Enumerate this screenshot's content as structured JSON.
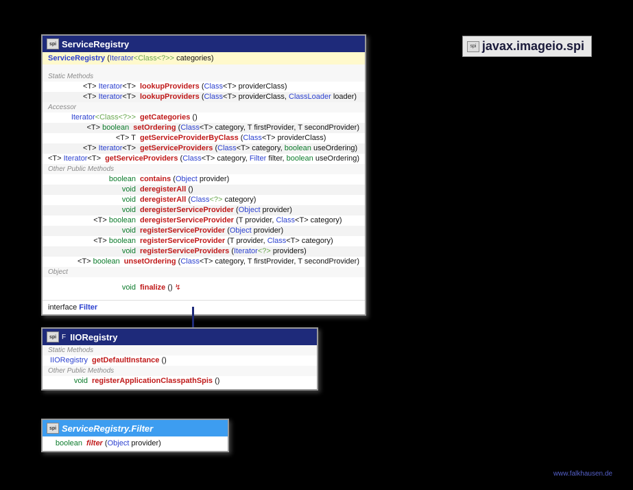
{
  "package": {
    "name": "javax.imageio.spi",
    "icon_label": "spi"
  },
  "footer": {
    "url": "www.falkhausen.de"
  },
  "service_registry": {
    "title": "ServiceRegistry",
    "constructor": {
      "name": "ServiceRegistry",
      "params": "(Iterator<Class<?>> categories)"
    },
    "sections": {
      "static": "Static Methods",
      "accessor": "Accessor",
      "other": "Other Public Methods",
      "object": "Object"
    },
    "static_methods": [
      {
        "ret_prefix": "<T> ",
        "ret": "Iterator<T>",
        "name": "lookupProviders",
        "params": "(Class<T> providerClass)"
      },
      {
        "ret_prefix": "<T> ",
        "ret": "Iterator<T>",
        "name": "lookupProviders",
        "params": "(Class<T> providerClass, ClassLoader loader)"
      }
    ],
    "accessor_methods": [
      {
        "ret_prefix": "",
        "ret": "Iterator<Class<?>>",
        "name": "getCategories",
        "params": "()"
      },
      {
        "ret_prefix": "<T> ",
        "ret": "boolean",
        "name": "setOrdering",
        "params": "(Class<T> category, T firstProvider, T secondProvider)"
      },
      {
        "ret_prefix": "<T> ",
        "ret": "T",
        "name": "getServiceProviderByClass",
        "params": "(Class<T> providerClass)"
      },
      {
        "ret_prefix": "<T> ",
        "ret": "Iterator<T>",
        "name": "getServiceProviders",
        "params_parts": [
          "(Class<T> category, ",
          "boolean",
          " useOrdering)"
        ]
      },
      {
        "ret_prefix": "<T> ",
        "ret": "Iterator<T>",
        "name": "getServiceProviders",
        "params_parts": [
          "(Class<T> category, ",
          "Filter",
          " filter, ",
          "boolean",
          " useOrdering)"
        ]
      }
    ],
    "other_methods": [
      {
        "ret_prefix": "",
        "ret_kw": "boolean",
        "name": "contains",
        "params": "(Object provider)"
      },
      {
        "ret_prefix": "",
        "ret_kw": "void",
        "name": "deregisterAll",
        "params": "()"
      },
      {
        "ret_prefix": "",
        "ret_kw": "void",
        "name": "deregisterAll",
        "params": "(Class<?> category)"
      },
      {
        "ret_prefix": "",
        "ret_kw": "void",
        "name": "deregisterServiceProvider",
        "params": "(Object provider)"
      },
      {
        "ret_prefix": "<T> ",
        "ret_kw": "boolean",
        "name": "deregisterServiceProvider",
        "params": "(T provider, Class<T> category)"
      },
      {
        "ret_prefix": "",
        "ret_kw": "void",
        "name": "registerServiceProvider",
        "params": "(Object provider)"
      },
      {
        "ret_prefix": "<T> ",
        "ret_kw": "boolean",
        "name": "registerServiceProvider",
        "params": "(T provider, Class<T> category)"
      },
      {
        "ret_prefix": "",
        "ret_kw": "void",
        "name": "registerServiceProviders",
        "params": "(Iterator<?> providers)"
      },
      {
        "ret_prefix": "<T> ",
        "ret_kw": "boolean",
        "name": "unsetOrdering",
        "params": "(Class<T> category, T firstProvider, T secondProvider)"
      }
    ],
    "object_methods": [
      {
        "ret_kw": "void",
        "name": "finalize",
        "params": "()",
        "throws_mark": "↯"
      }
    ],
    "inner": {
      "label": "interface",
      "name": "Filter"
    }
  },
  "iio_registry": {
    "title": "IIORegistry",
    "modifier": "F",
    "sections": {
      "static": "Static Methods",
      "other": "Other Public Methods"
    },
    "static_methods": [
      {
        "ret": "IIORegistry",
        "name": "getDefaultInstance",
        "params": "()"
      }
    ],
    "other_methods": [
      {
        "ret_kw": "void",
        "name": "registerApplicationClasspathSpis",
        "params": "()"
      }
    ]
  },
  "filter_box": {
    "title": "ServiceRegistry.Filter",
    "method": {
      "ret_kw": "boolean",
      "name": "filter",
      "params": "(Object provider)"
    }
  }
}
